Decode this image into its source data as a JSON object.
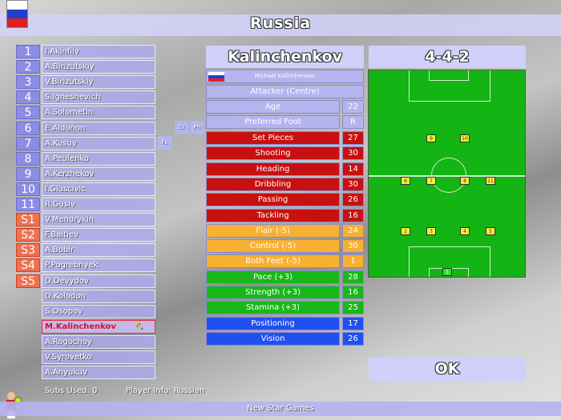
{
  "title": "Russia",
  "flag_colors": [
    "#ffffff",
    "#2040d0",
    "#e02020"
  ],
  "team": {
    "first_eleven": [
      {
        "num": "1",
        "name": "I.Akinfiiv"
      },
      {
        "num": "2",
        "name": "A.Birizutskiy"
      },
      {
        "num": "3",
        "name": "V.Birizutskiy"
      },
      {
        "num": "4",
        "name": "S.Igneshevich"
      },
      {
        "num": "5",
        "name": "A.Solometin"
      },
      {
        "num": "6",
        "name": "E.Aldonon"
      },
      {
        "num": "7",
        "name": "A.Kusuv"
      },
      {
        "num": "8",
        "name": "A.Peulenko"
      },
      {
        "num": "9",
        "name": "A.Kerzhekov"
      },
      {
        "num": "10",
        "name": "I.Gluscivic"
      },
      {
        "num": "11",
        "name": "R.Gusiv"
      }
    ],
    "subs": [
      {
        "num": "S1",
        "name": "V.Mendrykin"
      },
      {
        "num": "S2",
        "name": "F.Baitiev"
      },
      {
        "num": "S3",
        "name": "A.Bobir"
      },
      {
        "num": "S4",
        "name": "P.Pogrebnyek"
      },
      {
        "num": "S5",
        "name": "D.Devydov"
      }
    ],
    "reserves": [
      "D.Kolodon",
      "S.Osopov",
      "M.Kalinchenkov",
      "A.Rogochoy",
      "V.Syrovetko",
      "A.Anyukuv"
    ],
    "selected": "M.Kalinchenkov",
    "role_buttons": {
      "corners": "Cr",
      "penalties": "Pn",
      "free_kicks": "Fk"
    }
  },
  "player": {
    "surname": "Kalinchenkov",
    "full_name": "Michael Kalinchenkov",
    "position": "Attacker (Centre)",
    "info": [
      {
        "label": "Age",
        "value": "22"
      },
      {
        "label": "Preferred Foot",
        "value": "R"
      }
    ],
    "stats": [
      {
        "label": "Set Pieces",
        "value": "27",
        "color": "#c81010"
      },
      {
        "label": "Shooting",
        "value": "30",
        "color": "#c81010"
      },
      {
        "label": "Heading",
        "value": "14",
        "color": "#c81010"
      },
      {
        "label": "Dribbling",
        "value": "30",
        "color": "#c81010"
      },
      {
        "label": "Passing",
        "value": "26",
        "color": "#c81010"
      },
      {
        "label": "Tackling",
        "value": "16",
        "color": "#c81010"
      },
      {
        "label": "Flair (-5)",
        "value": "24",
        "color": "#f8b030"
      },
      {
        "label": "Control (-5)",
        "value": "30",
        "color": "#f8b030"
      },
      {
        "label": "Both Feet (-5)",
        "value": "1",
        "color": "#f8b030"
      },
      {
        "label": "Pace (+3)",
        "value": "28",
        "color": "#18b818"
      },
      {
        "label": "Strength (+3)",
        "value": "16",
        "color": "#18b818"
      },
      {
        "label": "Stamina (+3)",
        "value": "25",
        "color": "#18b818"
      },
      {
        "label": "Positioning",
        "value": "17",
        "color": "#2050f0"
      },
      {
        "label": "Vision",
        "value": "26",
        "color": "#2050f0"
      }
    ]
  },
  "formation": {
    "label": "4-4-2",
    "shirts": [
      {
        "n": "9",
        "r": 0,
        "c": 1
      },
      {
        "n": "10",
        "r": 0,
        "c": 2
      },
      {
        "n": "6",
        "r": 1,
        "c": 0
      },
      {
        "n": "7",
        "r": 1,
        "c": 1
      },
      {
        "n": "8",
        "r": 1,
        "c": 2
      },
      {
        "n": "11",
        "r": 1,
        "c": 3
      },
      {
        "n": "2",
        "r": 2,
        "c": 0
      },
      {
        "n": "3",
        "r": 2,
        "c": 1
      },
      {
        "n": "4",
        "r": 2,
        "c": 2
      },
      {
        "n": "5",
        "r": 2,
        "c": 3
      },
      {
        "n": "1",
        "r": 3,
        "c": -1
      }
    ]
  },
  "ok_label": "OK",
  "footer": {
    "subs_used": "Subs Used: 0",
    "player_info": "Player Info: Russian",
    "brand": "New Star Games"
  }
}
